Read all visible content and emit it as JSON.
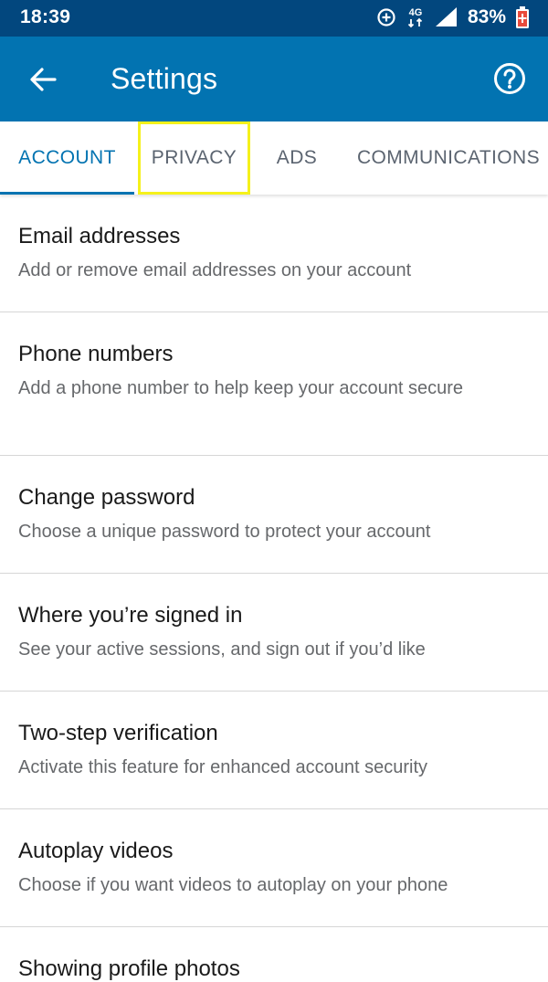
{
  "status_bar": {
    "time": "18:39",
    "network": "4G",
    "battery": "83%",
    "icons": [
      "data-saver-icon",
      "network-4g-icon",
      "signal-icon",
      "battery-icon"
    ]
  },
  "app_bar": {
    "title": "Settings",
    "back_icon": "arrow-left-icon",
    "help_icon": "help-circle-icon",
    "background": "#0273b1"
  },
  "tabs": [
    {
      "label": "ACCOUNT",
      "active": true
    },
    {
      "label": "PRIVACY",
      "active": false,
      "highlighted": true
    },
    {
      "label": "ADS",
      "active": false
    },
    {
      "label": "COMMUNICATIONS",
      "active": false
    }
  ],
  "settings": [
    {
      "title": "Email addresses",
      "subtitle": "Add or remove email addresses on your account"
    },
    {
      "title": "Phone numbers",
      "subtitle": "Add a phone number to help keep your account secure"
    },
    {
      "title": "Change password",
      "subtitle": "Choose a unique password to protect your account"
    },
    {
      "title": "Where you’re signed in",
      "subtitle": "See your active sessions, and sign out if you’d like"
    },
    {
      "title": "Two-step verification",
      "subtitle": "Activate this feature for enhanced account security"
    },
    {
      "title": "Autoplay videos",
      "subtitle": "Choose if you want videos to autoplay on your phone"
    },
    {
      "title": "Showing profile photos",
      "subtitle": ""
    }
  ],
  "colors": {
    "status_bar": "#02477e",
    "accent": "#0273b1",
    "highlight": "#f5f11b"
  }
}
